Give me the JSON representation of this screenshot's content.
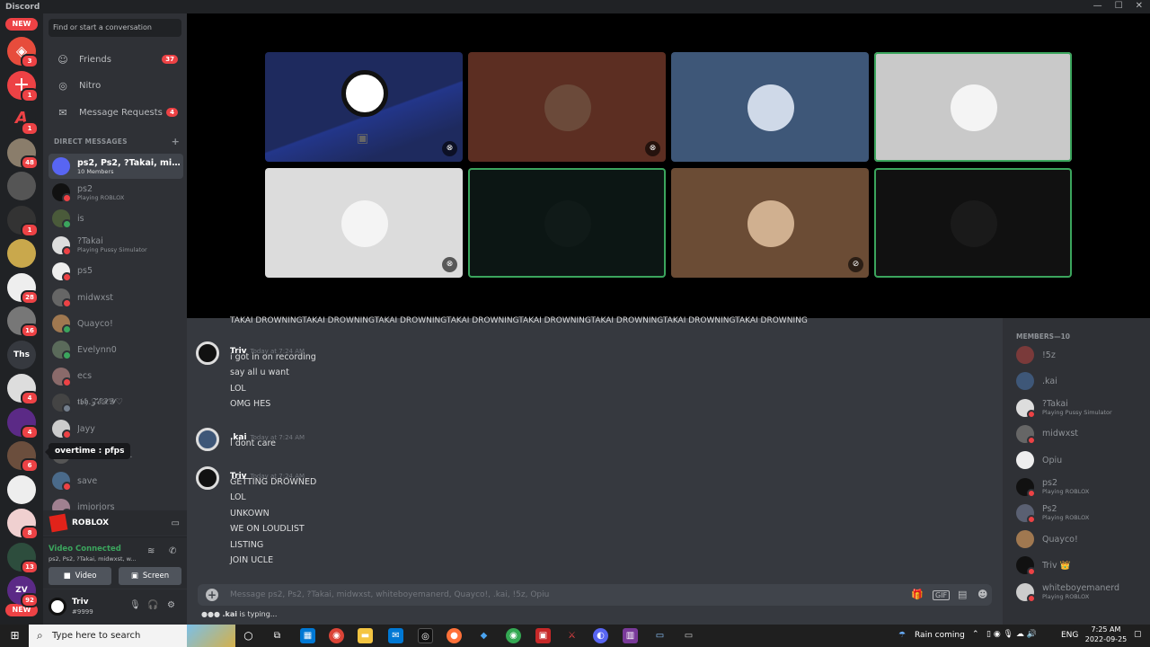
{
  "window": {
    "title": "Discord"
  },
  "servers": {
    "items": [
      {
        "icon": "roblox-server-icon",
        "badge": "3",
        "color": "#e74c3c"
      },
      {
        "icon": "add-server-icon",
        "badge": "1",
        "color": "#ed4245"
      },
      {
        "icon": "letter-a-server-icon",
        "badge": "1",
        "color": "#202225"
      },
      {
        "icon": "server-avatar",
        "badge": "48",
        "color": "#8a7d6b"
      },
      {
        "icon": "server-avatar",
        "badge": "",
        "color": "#555"
      },
      {
        "icon": "server-avatar",
        "badge": "1",
        "color": "#333"
      },
      {
        "icon": "server-avatar",
        "badge": "",
        "color": "#c9a84c"
      },
      {
        "icon": "server-avatar",
        "badge": "28",
        "color": "#eee"
      },
      {
        "icon": "server-avatar",
        "badge": "16",
        "color": "#777"
      },
      {
        "icon": "text-server-icon",
        "badge": "",
        "color": "#36393f",
        "label": "Ths"
      },
      {
        "icon": "server-avatar",
        "badge": "4",
        "color": "#ddd"
      },
      {
        "icon": "server-avatar",
        "badge": "4",
        "color": "#5b2a86"
      },
      {
        "icon": "server-avatar",
        "badge": "6",
        "color": "#6b4e3d"
      },
      {
        "icon": "server-avatar",
        "badge": "",
        "color": "#eee"
      },
      {
        "icon": "server-avatar",
        "badge": "8",
        "color": "#f0d0d0"
      },
      {
        "icon": "server-avatar",
        "badge": "13",
        "color": "#2d4d3d"
      },
      {
        "icon": "server-avatar",
        "badge": "92",
        "color": "#5b2a86",
        "label": "ZV"
      }
    ],
    "new_label_top": "NEW",
    "new_label_bottom": "NEW"
  },
  "sidebar": {
    "search_placeholder": "Find or start a conversation",
    "nav": [
      {
        "label": "Friends",
        "icon": "friends-icon",
        "count": "37"
      },
      {
        "label": "Nitro",
        "icon": "nitro-icon",
        "count": ""
      },
      {
        "label": "Message Requests",
        "icon": "message-requests-icon",
        "count": "4"
      }
    ],
    "dm_header": "DIRECT MESSAGES",
    "dms": [
      {
        "name": "ps2, Ps2, ?Takai, midw...",
        "sub": "10 Members",
        "color": "#5865f2",
        "status": ""
      },
      {
        "name": "ps2",
        "sub": "Playing ROBLOX",
        "color": "#111",
        "status": "#ed4245"
      },
      {
        "name": "is",
        "sub": "",
        "color": "#4a5a3a",
        "status": "#3ba55d"
      },
      {
        "name": "?Takai",
        "sub": "Playing Pussy Simulator",
        "color": "#ddd",
        "status": "#ed4245"
      },
      {
        "name": "ps5",
        "sub": "",
        "color": "#eee",
        "status": "#ed4245"
      },
      {
        "name": "midwxst",
        "sub": "",
        "color": "#666",
        "status": "#ed4245"
      },
      {
        "name": "Quayco!",
        "sub": "",
        "color": "#a07850",
        "status": "#3ba55d"
      },
      {
        "name": "Evelynn0",
        "sub": "",
        "color": "#5a6a5a",
        "status": "#3ba55d"
      },
      {
        "name": "ecs",
        "sub": "",
        "color": "#8a6a6a",
        "status": "#ed4245"
      },
      {
        "name": "𝖙𝖇𝖍.𝓩𝓔𝓧𝓨♡",
        "sub": "",
        "color": "#444",
        "status": "#747f8d"
      },
      {
        "name": "Jayy",
        "sub": "",
        "color": "#ccc",
        "status": "#ed4245"
      },
      {
        "name": "ys, !Miomu...",
        "sub": "",
        "color": "#555",
        "status": ""
      },
      {
        "name": "save",
        "sub": "",
        "color": "#4a6a8a",
        "status": "#ed4245"
      },
      {
        "name": "imjorjors",
        "sub": "",
        "color": "#a08090",
        "status": "#ed4245"
      }
    ],
    "tooltip": "overtime : pfps",
    "activity": {
      "label": "ROBLOX"
    },
    "voice": {
      "status": "Video Connected",
      "members": "ps2, Ps2, ?Takai, midwxst, w...",
      "video_btn": "Video",
      "screen_btn": "Screen"
    },
    "user": {
      "name": "Triv",
      "tag": "#9999"
    }
  },
  "call": {
    "tiles": [
      {
        "bg": "#1e2a5e",
        "face": "obs",
        "mute": "mic-off-icon",
        "speaking": false,
        "camoff": true
      },
      {
        "bg": "#5c2e22",
        "face": "#6b4a3a",
        "mute": "mic-off-icon",
        "speaking": false
      },
      {
        "bg": "#3e5778",
        "face": "#cfd9e8",
        "mute": "",
        "speaking": false
      },
      {
        "bg": "#c9c9c9",
        "face": "#f4f4f4",
        "mute": "",
        "speaking": true
      },
      {
        "bg": "#dcdcdc",
        "face": "#f4f4f4",
        "mute": "mic-off-icon",
        "speaking": false
      },
      {
        "bg": "#0c1614",
        "face": "#101a18",
        "mute": "",
        "speaking": true
      },
      {
        "bg": "#6b4c35",
        "face": "#d0b090",
        "mute": "deafen-icon",
        "speaking": false
      },
      {
        "bg": "#111",
        "face": "#1a1a1a",
        "mute": "",
        "speaking": true
      }
    ]
  },
  "chat": {
    "truncated_line": "TAKAI DROWNINGTAKAI DROWNINGTAKAI DROWNINGTAKAI DROWNINGTAKAI DROWNINGTAKAI DROWNINGTAKAI DROWNINGTAKAI DROWNING",
    "messages": [
      {
        "author": "Triv",
        "time": "Today at 7:24 AM",
        "lines": [
          "i got in on recording",
          "say all u want",
          "LOL",
          "OMG HES"
        ]
      },
      {
        "author": ".kai",
        "time": "Today at 7:24 AM",
        "lines": [
          "I dont care"
        ]
      },
      {
        "author": "Triv",
        "time": "Today at 7:24 AM",
        "lines": [
          "GETTING DROWNED",
          "LOL",
          "UNKOWN",
          "WE ON LOUDLIST",
          "LISTING",
          "JOIN UCLE"
        ]
      }
    ],
    "composer_placeholder": "Message ps2, Ps2, ?Takai, midwxst, whiteboyemanerd, Quayco!, .kai, !5z, Opiu",
    "typing_user": ".kai",
    "typing_suffix": " is typing..."
  },
  "members": {
    "header": "MEMBERS—10",
    "list": [
      {
        "name": "!5z",
        "sub": "",
        "color": "#7a3a3a",
        "status": ""
      },
      {
        "name": ".kai",
        "sub": "",
        "color": "#3e5778",
        "status": ""
      },
      {
        "name": "?Takai",
        "sub": "Playing Pussy Simulator",
        "color": "#ddd",
        "status": "#ed4245"
      },
      {
        "name": "midwxst",
        "sub": "",
        "color": "#666",
        "status": "#ed4245"
      },
      {
        "name": "Opiu",
        "sub": "",
        "color": "#eee",
        "status": ""
      },
      {
        "name": "ps2",
        "sub": "Playing ROBLOX",
        "color": "#111",
        "status": "#ed4245"
      },
      {
        "name": "Ps2",
        "sub": "Playing ROBLOX",
        "color": "#5a6072",
        "status": "#ed4245"
      },
      {
        "name": "Quayco!",
        "sub": "",
        "color": "#a07850",
        "status": ""
      },
      {
        "name": "Triv 👑",
        "sub": "",
        "color": "#111",
        "status": "#ed4245"
      },
      {
        "name": "whiteboyemanerd",
        "sub": "Playing ROBLOX",
        "color": "#ccc",
        "status": "#ed4245"
      }
    ]
  },
  "taskbar": {
    "search_placeholder": "Type here to search",
    "weather": "Rain coming",
    "lang": "ENG",
    "time": "7:25 AM",
    "date": "2022-09-25"
  }
}
